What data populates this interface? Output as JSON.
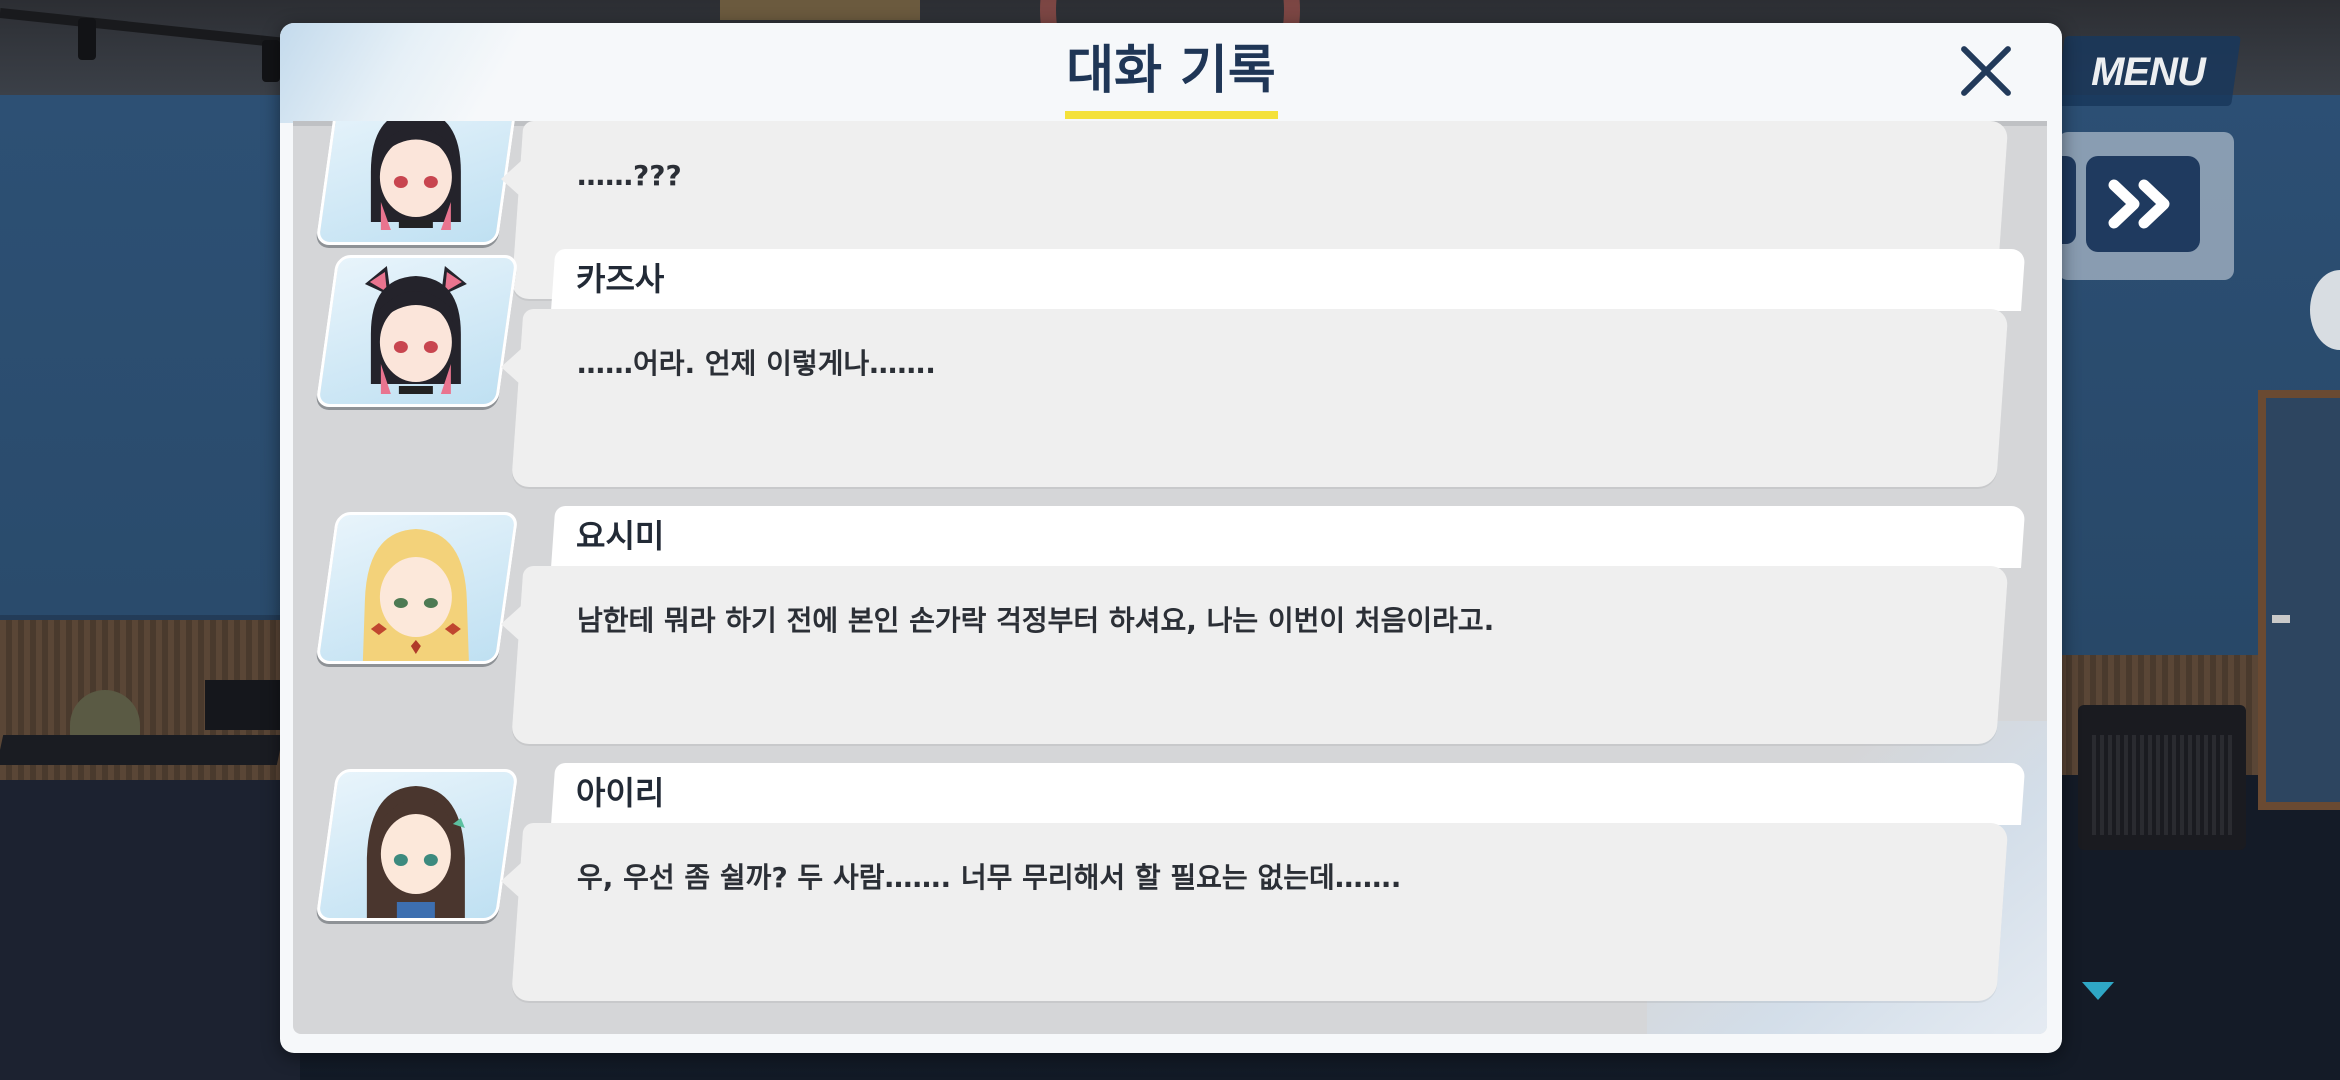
{
  "header": {
    "title": "대화 기록",
    "close_icon": "close-icon"
  },
  "menu": {
    "label": "MENU"
  },
  "controls": {
    "skip_icon": "fast-forward-icon",
    "scroll_down_icon": "caret-down-icon"
  },
  "entries": [
    {
      "name": "",
      "text": "……???",
      "portrait": "kazusa-portrait"
    },
    {
      "name": "카즈사",
      "text": "……어라. 언제 이렇게나…….",
      "portrait": "kazusa-portrait"
    },
    {
      "name": "요시미",
      "text": "남한테 뭐라 하기 전에 본인 손가락 걱정부터 하셔요, 나는 이번이 처음이라고.",
      "portrait": "yoshimi-portrait"
    },
    {
      "name": "아이리",
      "text": "우, 우선 좀 쉴까? 두 사람……. 너무 무리해서 할 필요는 없는데…….",
      "portrait": "airi-portrait"
    }
  ],
  "colors": {
    "title": "#1f3656",
    "underline": "#f4e13a",
    "skip_button": "#1f3a5f"
  }
}
